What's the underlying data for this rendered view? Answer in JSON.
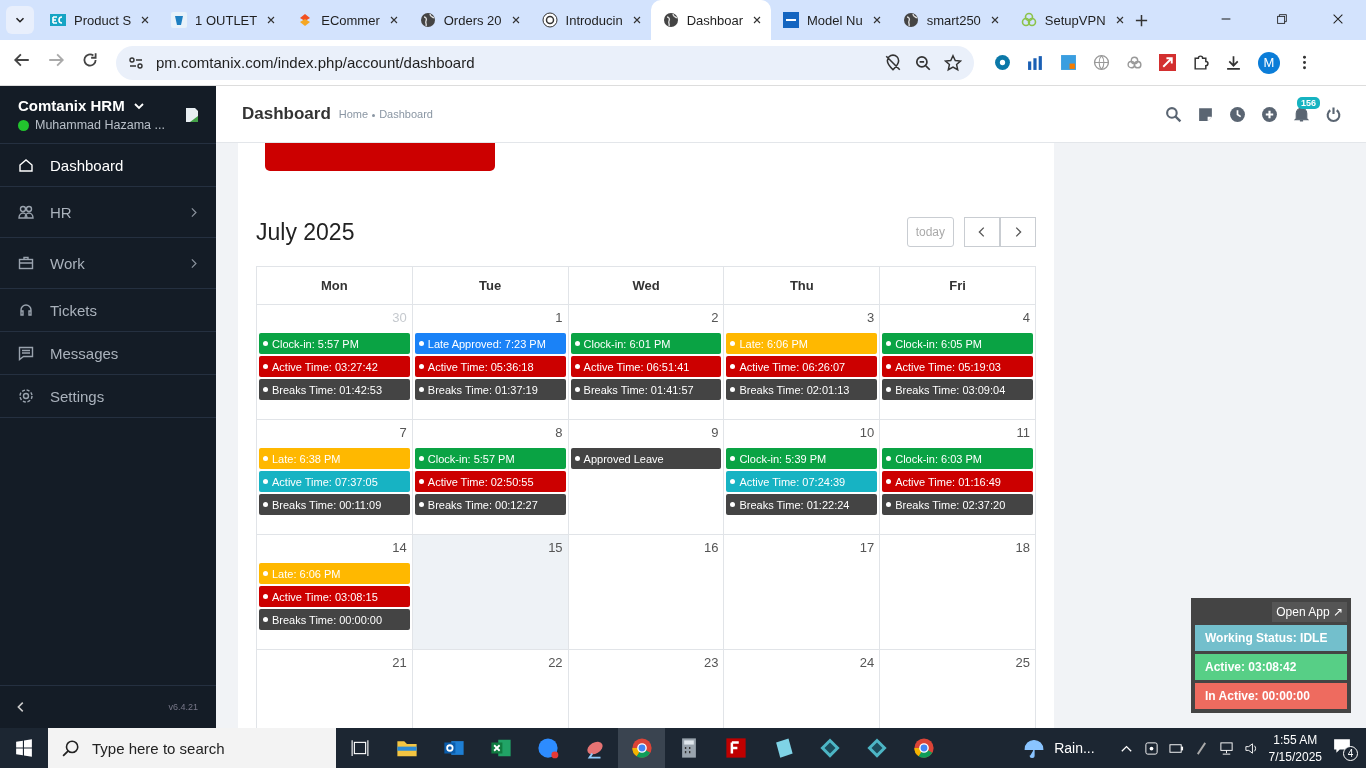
{
  "browser": {
    "tabs": [
      {
        "title": "Product S",
        "kind": "ec",
        "selected": false
      },
      {
        "title": "1 OUTLET",
        "kind": "outlet",
        "selected": false
      },
      {
        "title": "ECommer",
        "kind": "ecomm",
        "selected": false
      },
      {
        "title": "Orders 20",
        "kind": "globe",
        "selected": false
      },
      {
        "title": "Introducin",
        "kind": "spiral",
        "selected": false
      },
      {
        "title": "Dashboar",
        "kind": "globe",
        "selected": true
      },
      {
        "title": "Model Nu",
        "kind": "etn",
        "selected": false
      },
      {
        "title": "smart250",
        "kind": "globe",
        "selected": false
      },
      {
        "title": "SetupVPN",
        "kind": "vpn",
        "selected": false
      }
    ],
    "url": "pm.comtanix.com/index.php/account/dashboard",
    "profile": "M"
  },
  "sidebar": {
    "brand": "Comtanix HRM",
    "user": "Muhammad Hazama ...",
    "items": [
      {
        "label": "Dashboard",
        "kind": "home",
        "selected": true,
        "submenu": false
      },
      {
        "label": "HR",
        "kind": "people",
        "selected": false,
        "submenu": true
      },
      {
        "label": "Work",
        "kind": "briefcase",
        "selected": false,
        "submenu": true
      },
      {
        "label": "Tickets",
        "kind": "headset",
        "selected": false,
        "submenu": false
      },
      {
        "label": "Messages",
        "kind": "message",
        "selected": false,
        "submenu": false
      },
      {
        "label": "Settings",
        "kind": "gear",
        "selected": false,
        "submenu": false
      }
    ],
    "version": "v6.4.21"
  },
  "header": {
    "title": "Dashboard",
    "breadcrumb": [
      "Home",
      "Dashboard"
    ],
    "notifications": "156"
  },
  "calendar": {
    "title": "July 2025",
    "today_button": "today",
    "columns": [
      "Mon",
      "Tue",
      "Wed",
      "Thu",
      "Fri"
    ],
    "weeks": [
      {
        "days": [
          {
            "date": "30",
            "other_month": true,
            "today": false,
            "events": [
              {
                "text": "Clock-in: 5:57 PM",
                "color": "#0aa344"
              },
              {
                "text": "Active Time: 03:27:42",
                "color": "#cc0000"
              },
              {
                "text": "Breaks Time: 01:42:53",
                "color": "#444444"
              }
            ]
          },
          {
            "date": "1",
            "other_month": false,
            "today": false,
            "events": [
              {
                "text": "Late Approved: 7:23 PM",
                "color": "#1a82f7"
              },
              {
                "text": "Active Time: 05:36:18",
                "color": "#cc0000"
              },
              {
                "text": "Breaks Time: 01:37:19",
                "color": "#444444"
              }
            ]
          },
          {
            "date": "2",
            "other_month": false,
            "today": false,
            "events": [
              {
                "text": "Clock-in: 6:01 PM",
                "color": "#0aa344"
              },
              {
                "text": "Active Time: 06:51:41",
                "color": "#cc0000"
              },
              {
                "text": "Breaks Time: 01:41:57",
                "color": "#444444"
              }
            ]
          },
          {
            "date": "3",
            "other_month": false,
            "today": false,
            "events": [
              {
                "text": "Late: 6:06 PM",
                "color": "#ffb800"
              },
              {
                "text": "Active Time: 06:26:07",
                "color": "#cc0000"
              },
              {
                "text": "Breaks Time: 02:01:13",
                "color": "#444444"
              }
            ]
          },
          {
            "date": "4",
            "other_month": false,
            "today": false,
            "events": [
              {
                "text": "Clock-in: 6:05 PM",
                "color": "#0aa344"
              },
              {
                "text": "Active Time: 05:19:03",
                "color": "#cc0000"
              },
              {
                "text": "Breaks Time: 03:09:04",
                "color": "#444444"
              }
            ]
          }
        ]
      },
      {
        "days": [
          {
            "date": "7",
            "other_month": false,
            "today": false,
            "events": [
              {
                "text": "Late: 6:38 PM",
                "color": "#ffb800"
              },
              {
                "text": "Active Time: 07:37:05",
                "color": "#17b3c3"
              },
              {
                "text": "Breaks Time: 00:11:09",
                "color": "#444444"
              }
            ]
          },
          {
            "date": "8",
            "other_month": false,
            "today": false,
            "events": [
              {
                "text": "Clock-in: 5:57 PM",
                "color": "#0aa344"
              },
              {
                "text": "Active Time: 02:50:55",
                "color": "#cc0000"
              },
              {
                "text": "Breaks Time: 00:12:27",
                "color": "#444444"
              }
            ]
          },
          {
            "date": "9",
            "other_month": false,
            "today": false,
            "events": [
              {
                "text": "Approved Leave",
                "color": "#444444"
              }
            ]
          },
          {
            "date": "10",
            "other_month": false,
            "today": false,
            "events": [
              {
                "text": "Clock-in: 5:39 PM",
                "color": "#0aa344"
              },
              {
                "text": "Active Time: 07:24:39",
                "color": "#17b3c3"
              },
              {
                "text": "Breaks Time: 01:22:24",
                "color": "#444444"
              }
            ]
          },
          {
            "date": "11",
            "other_month": false,
            "today": false,
            "events": [
              {
                "text": "Clock-in: 6:03 PM",
                "color": "#0aa344"
              },
              {
                "text": "Active Time: 01:16:49",
                "color": "#cc0000"
              },
              {
                "text": "Breaks Time: 02:37:20",
                "color": "#444444"
              }
            ]
          }
        ]
      },
      {
        "days": [
          {
            "date": "14",
            "other_month": false,
            "today": false,
            "events": [
              {
                "text": "Late: 6:06 PM",
                "color": "#ffb800"
              },
              {
                "text": "Active Time: 03:08:15",
                "color": "#cc0000"
              },
              {
                "text": "Breaks Time: 00:00:00",
                "color": "#444444"
              }
            ]
          },
          {
            "date": "15",
            "other_month": false,
            "today": true
          },
          {
            "date": "16",
            "other_month": false,
            "today": false
          },
          {
            "date": "17",
            "other_month": false,
            "today": false
          },
          {
            "date": "18",
            "other_month": false,
            "today": false
          }
        ]
      },
      {
        "days": [
          {
            "date": "21",
            "other_month": false,
            "today": false
          },
          {
            "date": "22",
            "other_month": false,
            "today": false
          },
          {
            "date": "23",
            "other_month": false,
            "today": false
          },
          {
            "date": "24",
            "other_month": false,
            "today": false
          },
          {
            "date": "25",
            "other_month": false,
            "today": false
          }
        ]
      }
    ]
  },
  "tracker": {
    "open_button": "Open App ↗",
    "rows": [
      {
        "text": "Working Status: IDLE",
        "color": "#73bfcc"
      },
      {
        "text": "Active: 03:08:42",
        "color": "#57cf86"
      },
      {
        "text": "In Active: 00:00:00",
        "color": "#ee6b5f"
      }
    ]
  },
  "taskbar": {
    "search_placeholder": "Type here to search",
    "weather": "Rain...",
    "time": "1:55 AM",
    "date": "7/15/2025",
    "notifications": "4"
  }
}
